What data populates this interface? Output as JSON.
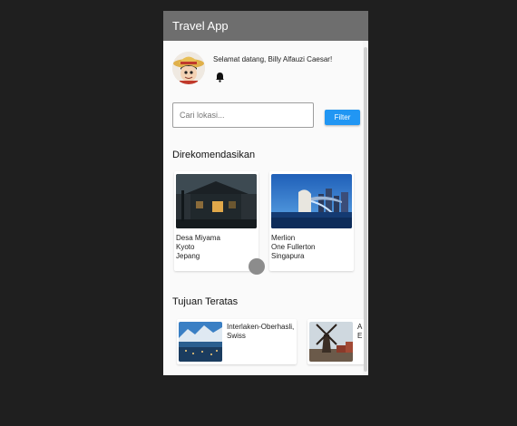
{
  "app": {
    "title": "Travel App"
  },
  "header": {
    "greeting": "Selamat datang, Billy Alfauzi Caesar!"
  },
  "search": {
    "placeholder": "Cari lokasi...",
    "value": "",
    "filter_label": "Filter"
  },
  "recommended": {
    "title": "Direkomendasikan",
    "items": [
      {
        "name": "Desa Miyama",
        "city": "Kyoto",
        "country": "Jepang"
      },
      {
        "name": "Merlion",
        "city": "One Fullerton",
        "country": "Singapura"
      }
    ]
  },
  "top_destinations": {
    "title": "Tujuan Teratas",
    "items": [
      {
        "name": "Interlaken-Oberhasli,",
        "country": "Swiss"
      },
      {
        "name": "A",
        "country": "E"
      }
    ]
  },
  "colors": {
    "appbar": "#6e6e6e",
    "accent": "#2196f3",
    "background": "#1f1f1f"
  },
  "icons": {
    "notification": "bell-icon",
    "profile": "avatar"
  }
}
